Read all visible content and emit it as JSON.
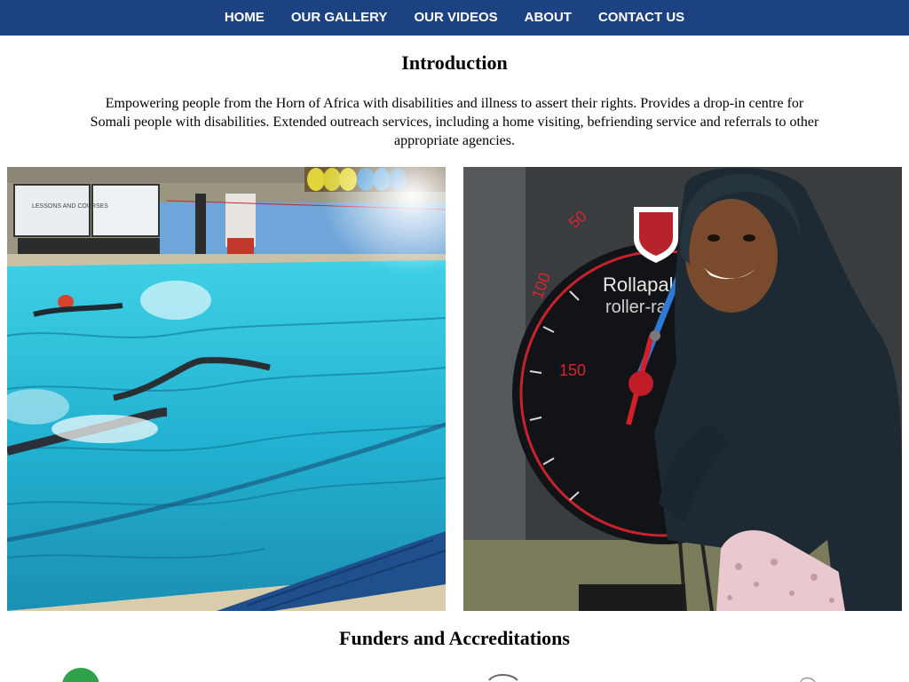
{
  "nav": {
    "items": [
      {
        "label": "HOME"
      },
      {
        "label": "OUR GALLERY"
      },
      {
        "label": "OUR VIDEOS"
      },
      {
        "label": "ABOUT"
      },
      {
        "label": "CONTACT US"
      }
    ]
  },
  "intro": {
    "title": "Introduction",
    "body": "Empowering people from the Horn of Africa with disabilities and illness to assert their rights. Provides a drop-in centre for Somali people with disabilities. Extended outreach services, including a home visiting, befriending service and referrals to other appropriate agencies."
  },
  "gallery": {
    "left_photo": {
      "subject": "swimming-pool-photo",
      "signs": [
        "LESSONS AND COURSES"
      ]
    },
    "right_photo": {
      "subject": "woman-on-rollapaluza-bike-photo",
      "gauge_brand": "Rollapaluza",
      "gauge_subtitle": "roller-ra",
      "gauge_numbers": [
        "50",
        "100",
        "150"
      ]
    }
  },
  "funders": {
    "title": "Funders and Accreditations"
  },
  "colors": {
    "nav_bg": "#1c4282",
    "nav_text": "#ffffff",
    "page_bg": "#ffffff"
  }
}
